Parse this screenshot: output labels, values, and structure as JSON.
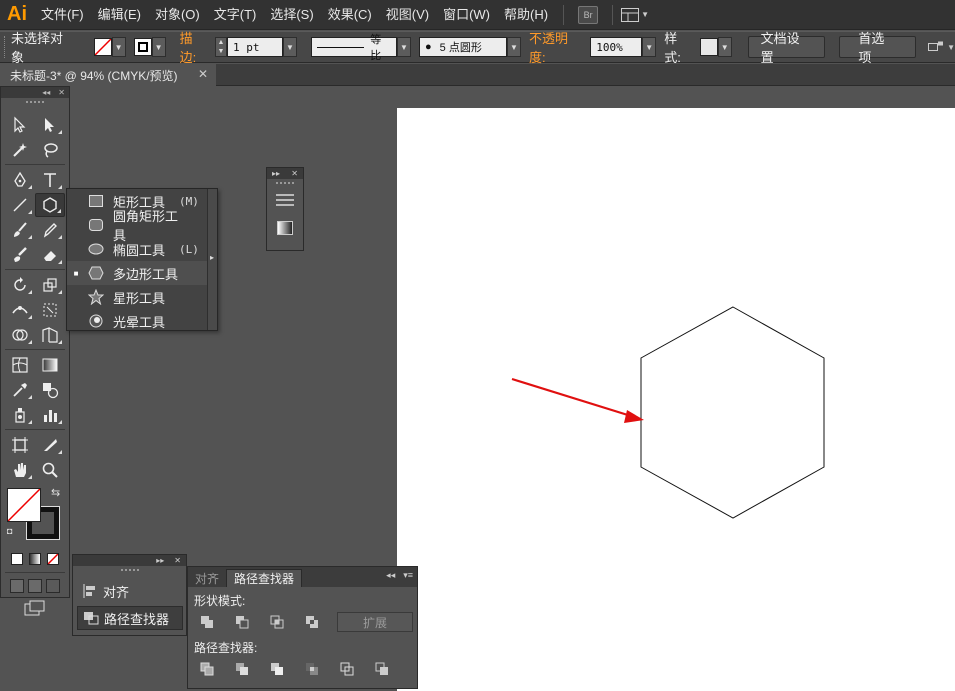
{
  "app": {
    "logo": "Ai"
  },
  "menu": [
    "文件(F)",
    "编辑(E)",
    "对象(O)",
    "文字(T)",
    "选择(S)",
    "效果(C)",
    "视图(V)",
    "窗口(W)",
    "帮助(H)"
  ],
  "menu_bridge": "Br",
  "control": {
    "selection": "未选择对象",
    "stroke_label": "描边:",
    "stroke_weight": "1 pt",
    "stroke_profile": "等比",
    "brush": "5 点圆形",
    "opacity_label": "不透明度:",
    "opacity_value": "100%",
    "style_label": "样式:",
    "doc_setup": "文档设置",
    "preferences": "首选项"
  },
  "document_tab": {
    "title": "未标题-3* @ 94% (CMYK/预览)",
    "close": "✕"
  },
  "flyout": [
    {
      "label": "矩形工具",
      "shortcut": "(M)",
      "icon": "rectangle-icon",
      "selected": false
    },
    {
      "label": "圆角矩形工具",
      "shortcut": "",
      "icon": "rounded-rectangle-icon",
      "selected": false
    },
    {
      "label": "椭圆工具",
      "shortcut": "(L)",
      "icon": "ellipse-icon",
      "selected": false
    },
    {
      "label": "多边形工具",
      "shortcut": "",
      "icon": "polygon-icon",
      "selected": true
    },
    {
      "label": "星形工具",
      "shortcut": "",
      "icon": "star-icon",
      "selected": false
    },
    {
      "label": "光晕工具",
      "shortcut": "",
      "icon": "flare-icon",
      "selected": false
    }
  ],
  "left_panel": {
    "items": [
      "对齐",
      "路径查找器"
    ]
  },
  "pathfinder": {
    "tabs": [
      "对齐",
      "路径查找器"
    ],
    "shape_modes_label": "形状模式:",
    "pathfinders_label": "路径查找器:",
    "expand": "扩展"
  },
  "colors": {
    "accent": "#ff9a00",
    "arrow": "#e01010",
    "canvas": "#ffffff",
    "workspace": "#535353"
  }
}
